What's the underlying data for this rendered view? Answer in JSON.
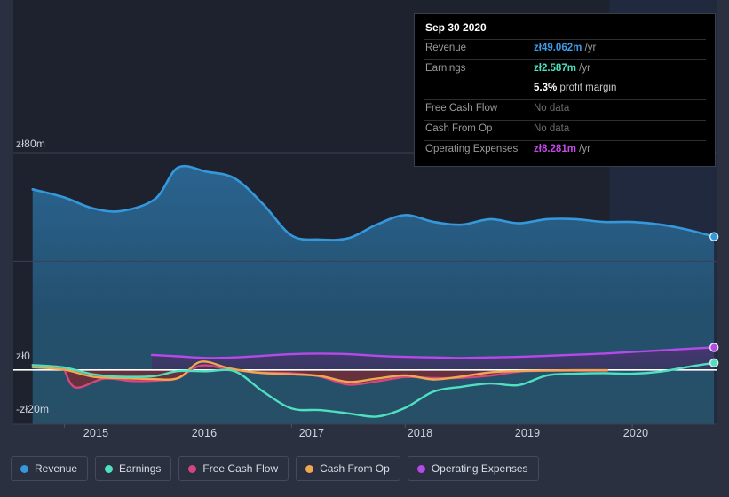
{
  "chart_data": {
    "type": "area",
    "title": "",
    "xlabel": "",
    "ylabel": "",
    "currency_prefix": "zł",
    "grid": true,
    "legend_position": "bottom",
    "xlim": [
      2014.55,
      2020.75
    ],
    "ylim": [
      -20,
      80
    ],
    "x_ticks": [
      "2015",
      "2016",
      "2017",
      "2018",
      "2019",
      "2020"
    ],
    "x_tick_values": [
      2015,
      2016,
      2017,
      2018,
      2019,
      2020
    ],
    "y_ticks": [
      "zł80m",
      "zł0",
      "-zł20m"
    ],
    "y_tick_values": [
      80,
      0,
      -20
    ],
    "forecast_start": 2019.8,
    "series": [
      {
        "name": "Revenue",
        "color": "#3498db",
        "filled": true,
        "x": [
          2014.72,
          2015.0,
          2015.25,
          2015.5,
          2015.8,
          2016.0,
          2016.25,
          2016.5,
          2016.75,
          2017.0,
          2017.25,
          2017.5,
          2017.75,
          2018.0,
          2018.25,
          2018.5,
          2018.75,
          2019.0,
          2019.25,
          2019.5,
          2019.75,
          2020.0,
          2020.25,
          2020.5,
          2020.72
        ],
        "values": [
          66.5,
          63.5,
          59.5,
          58.5,
          63.0,
          74.5,
          73.0,
          70.5,
          61.0,
          49.5,
          48.0,
          48.5,
          53.5,
          57.0,
          54.5,
          53.5,
          55.5,
          54.0,
          55.5,
          55.5,
          54.5,
          54.5,
          53.5,
          51.5,
          49.062
        ]
      },
      {
        "name": "Earnings",
        "color": "#4fe0c0",
        "filled": false,
        "x": [
          2014.72,
          2015.0,
          2015.25,
          2015.5,
          2015.8,
          2016.0,
          2016.25,
          2016.5,
          2016.75,
          2017.0,
          2017.25,
          2017.5,
          2017.75,
          2018.0,
          2018.25,
          2018.5,
          2018.75,
          2019.0,
          2019.25,
          2019.5,
          2019.75,
          2020.0,
          2020.25,
          2020.5,
          2020.72
        ],
        "values": [
          1.8,
          0.9,
          -1.6,
          -2.5,
          -2.2,
          -0.4,
          -0.5,
          -0.5,
          -8.0,
          -14.2,
          -14.8,
          -16.0,
          -17.2,
          -14.0,
          -8.0,
          -6.2,
          -5.0,
          -5.6,
          -2.0,
          -1.4,
          -1.2,
          -1.4,
          -0.6,
          1.2,
          2.587
        ]
      },
      {
        "name": "Free Cash Flow",
        "color": "#d4467e",
        "filled": false,
        "x": [
          2015.0,
          2015.1,
          2015.35,
          2015.6,
          2015.85,
          2016.0,
          2016.2,
          2016.45,
          2016.7,
          2017.0,
          2017.25,
          2017.5,
          2017.75,
          2018.0,
          2018.25,
          2018.5,
          2018.75,
          2019.0,
          2019.25,
          2019.5,
          2019.78
        ],
        "values": [
          0.0,
          -6.5,
          -3.2,
          -4.1,
          -3.8,
          -3.0,
          1.6,
          0.2,
          -0.9,
          -1.2,
          -2.4,
          -5.4,
          -4.2,
          -2.6,
          -3.0,
          -2.9,
          -2.1,
          -0.6,
          -0.3,
          -0.3,
          -0.3
        ]
      },
      {
        "name": "Cash From Op",
        "color": "#f0a850",
        "filled": false,
        "x": [
          2014.72,
          2015.0,
          2015.25,
          2015.5,
          2015.75,
          2016.0,
          2016.2,
          2016.45,
          2016.7,
          2017.0,
          2017.25,
          2017.5,
          2017.75,
          2018.0,
          2018.25,
          2018.5,
          2018.75,
          2019.0,
          2019.25,
          2019.5,
          2019.78
        ],
        "values": [
          1.0,
          0.1,
          -2.5,
          -3.0,
          -3.3,
          -3.0,
          3.0,
          0.6,
          -1.0,
          -1.6,
          -2.2,
          -4.4,
          -3.2,
          -2.0,
          -3.5,
          -2.4,
          -0.9,
          -0.4,
          -0.2,
          -0.1,
          -0.1
        ]
      },
      {
        "name": "Operating Expenses",
        "color": "#b44ae8",
        "filled": true,
        "x": [
          2015.77,
          2016.0,
          2016.25,
          2016.5,
          2016.75,
          2017.0,
          2017.25,
          2017.5,
          2017.75,
          2018.0,
          2018.25,
          2018.5,
          2018.75,
          2019.0,
          2019.25,
          2019.5,
          2019.75,
          2020.0,
          2020.25,
          2020.5,
          2020.72
        ],
        "values": [
          5.5,
          5.0,
          4.4,
          4.6,
          5.2,
          5.8,
          6.0,
          5.8,
          5.2,
          4.8,
          4.6,
          4.4,
          4.6,
          4.8,
          5.2,
          5.6,
          6.0,
          6.6,
          7.2,
          7.8,
          8.281
        ]
      }
    ]
  },
  "tooltip": {
    "date": "Sep 30 2020",
    "rows": [
      {
        "label": "Revenue",
        "value": "zł49.062m",
        "unit": "/yr",
        "color": "#3d9ae8",
        "nodata": false
      },
      {
        "label": "Earnings",
        "value": "zł2.587m",
        "unit": "/yr",
        "color": "#4fe0c0",
        "nodata": false
      },
      {
        "label": "Free Cash Flow",
        "value": "No data",
        "unit": "",
        "color": "#6d6d6d",
        "nodata": true
      },
      {
        "label": "Cash From Op",
        "value": "No data",
        "unit": "",
        "color": "#6d6d6d",
        "nodata": true
      },
      {
        "label": "Operating Expenses",
        "value": "zł8.281m",
        "unit": "/yr",
        "color": "#c24ae8",
        "nodata": false
      }
    ],
    "profit_margin_value": "5.3%",
    "profit_margin_label": "profit margin"
  },
  "legend": {
    "items": [
      {
        "label": "Revenue",
        "color": "#3498db"
      },
      {
        "label": "Earnings",
        "color": "#4fe0c0"
      },
      {
        "label": "Free Cash Flow",
        "color": "#d4467e"
      },
      {
        "label": "Cash From Op",
        "color": "#f0a850"
      },
      {
        "label": "Operating Expenses",
        "color": "#b44ae8"
      }
    ]
  },
  "colors": {
    "page_background": "#2b3040",
    "plot_background": "#1d222e",
    "forecast_background": "#1f2a3a",
    "negative_fill": "#5c2b35",
    "zero_line": "#ffffff",
    "grid_line": "#3b4150"
  }
}
